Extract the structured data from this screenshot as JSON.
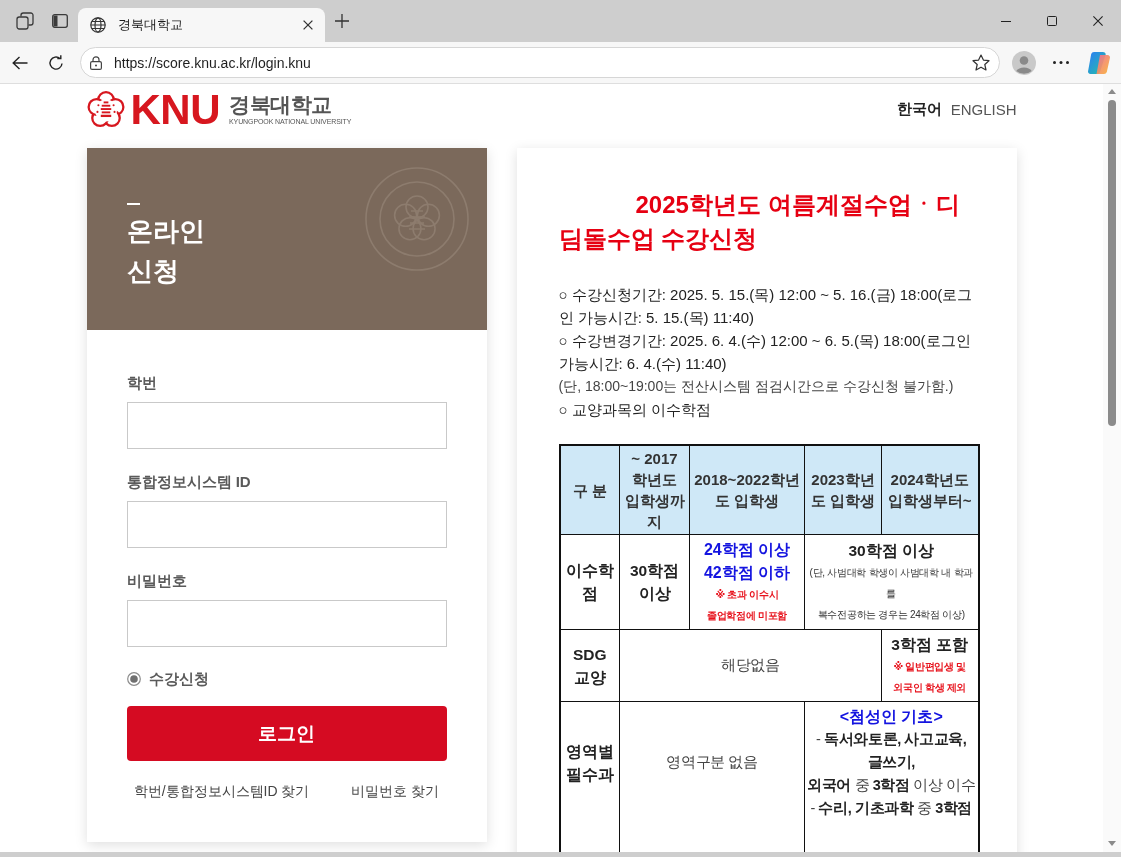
{
  "browser": {
    "tabs": [
      {
        "title": "경북대학교",
        "selected": true
      }
    ],
    "address": "https://score.knu.ac.kr/login.knu"
  },
  "header": {
    "logo": {
      "wordmark": "KNU",
      "name": "경북대학교",
      "subtitle": "KYUNGPOOK NATIONAL UNIVERSITY"
    },
    "languages": [
      {
        "label": "한국어",
        "selected": true
      },
      {
        "label": "ENGLISH",
        "selected": false
      }
    ]
  },
  "login": {
    "title": "온라인 신청",
    "fields": [
      {
        "label": "학번"
      },
      {
        "label": "통합정보시스템 ID"
      },
      {
        "label": "비밀번호"
      }
    ],
    "options": [
      {
        "label": "수강신청",
        "selected": true
      }
    ],
    "submit": "로그인",
    "links": [
      "학번/통합정보시스템ID 찾기",
      "비밀번호 찾기"
    ]
  },
  "notice": {
    "title": "2025학년도 여름계절수업ㆍ디딤돌수업 수강신청",
    "paragraphs": [
      {
        "kind": "item",
        "text": "○ 수강신청기간: 2025. 5. 15.(목) 12:00 ~ 5. 16.(금) 18:00(로그인 가능시간: 5. 15.(목) 11:40)"
      },
      {
        "kind": "item",
        "text": "○ 수강변경기간: 2025. 6. 4.(수) 12:00 ~ 6. 5.(목) 18:00(로그인 가능시간: 6. 4.(수) 11:40)"
      },
      {
        "kind": "note",
        "text": "(단, 18:00~19:00는 전산시스템 점검시간으로 수강신청 불가함.)"
      },
      {
        "kind": "item",
        "text": "○ 교양과목의 이수학점"
      }
    ],
    "table": {
      "columns": [
        "구 분",
        "~ 2017 학년도 입학생까지",
        "2018~2022학년도 입학생",
        "2023학년도 입학생",
        "2024학년도 입학생부터~"
      ],
      "rows": [
        {
          "cells": [
            {
              "lines": [
                {
                  "kind": "bold",
                  "text": "이수학점"
                }
              ]
            },
            {
              "lines": [
                {
                  "kind": "bold",
                  "text": "30학점 이상"
                }
              ]
            },
            {
              "lines": [
                {
                  "kind": "highlight",
                  "text": "24학점 이상"
                },
                {
                  "kind": "highlight",
                  "text": "42학점 이하"
                },
                {
                  "kind": "warning",
                  "text": "※ 초과 이수시 졸업학점에 미포함"
                }
              ]
            },
            {
              "colspan": 2,
              "lines": [
                {
                  "kind": "bold",
                  "text": "30학점 이상"
                },
                {
                  "kind": "note",
                  "text": "(단, 사범대학 학생이 사범대학 내 학과를"
                },
                {
                  "kind": "note",
                  "text": "복수전공하는 경우는 24학점 이상)"
                }
              ]
            }
          ]
        },
        {
          "cells": [
            {
              "lines": [
                {
                  "kind": "bold",
                  "text": "SDG 교양"
                }
              ]
            },
            {
              "colspan": 3,
              "lines": [
                {
                  "kind": "plain",
                  "text": "해당없음"
                }
              ]
            },
            {
              "lines": [
                {
                  "kind": "bold",
                  "text": "3학점 포함"
                },
                {
                  "kind": "warning",
                  "text": "※ 일반편입생 및 외국인 학생 제외"
                }
              ]
            }
          ]
        },
        {
          "cells": [
            {
              "lines": [
                {
                  "kind": "bold",
                  "text": "영역별 필수과"
                }
              ]
            },
            {
              "colspan": 2,
              "lines": [
                {
                  "kind": "plain",
                  "text": "영역구분 없음"
                }
              ]
            },
            {
              "colspan": 2,
              "lines": [
                {
                  "kind": "highlight",
                  "text": "<첨성인 기초>"
                },
                {
                  "kind": "plain",
                  "text": "- **독서와토론, 사고교육, 글쓰기,**"
                },
                {
                  "kind": "plain",
                  "text": "**외국어** 중 **3학점** 이상 이수"
                },
                {
                  "kind": "plain",
                  "text": "- **수리, 기초과학** 중 **3학점**"
                }
              ]
            }
          ]
        }
      ]
    }
  }
}
